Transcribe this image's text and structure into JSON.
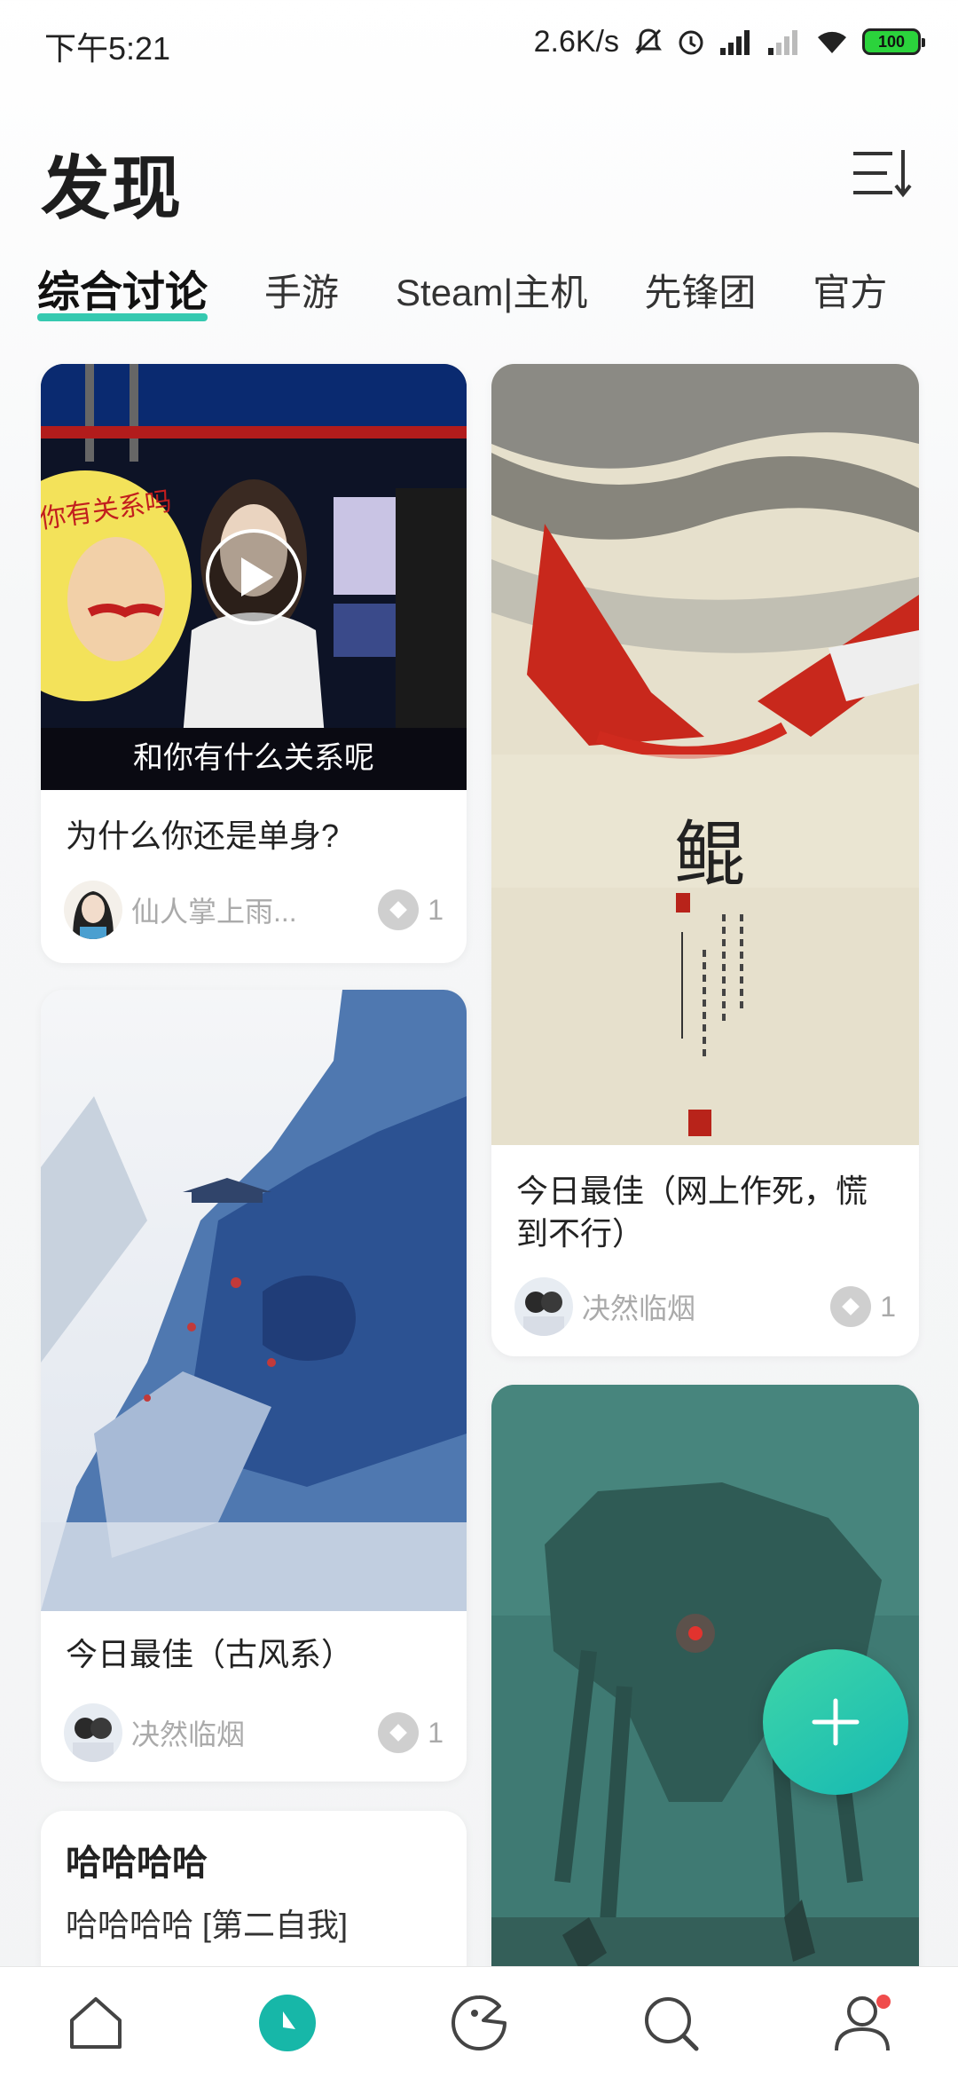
{
  "status_bar": {
    "time": "下午5:21",
    "net_speed": "2.6K/s",
    "battery": "100"
  },
  "header": {
    "title": "发现"
  },
  "tabs": [
    {
      "label": "综合讨论",
      "active": true
    },
    {
      "label": "手游"
    },
    {
      "label": "Steam|主机"
    },
    {
      "label": "先锋团"
    },
    {
      "label": "官方"
    }
  ],
  "cards": {
    "c1": {
      "title": "为什么你还是单身?",
      "author": "仙人掌上雨...",
      "likes": "1",
      "subtitle_text": "和你有什么关系呢",
      "sign_text": "你有关系吗"
    },
    "c2": {
      "title": "今日最佳（网上作死，慌到不行）",
      "author": "决然临烟",
      "likes": "1",
      "calligraphy": "鲲"
    },
    "c3": {
      "title": "今日最佳（古风系）",
      "author": "决然临烟",
      "likes": "1"
    },
    "c4": {
      "title": "哈哈哈哈",
      "body": "哈哈哈哈 [第二自我]"
    }
  },
  "colors": {
    "accent": "#35c9b0",
    "fab": "#1bbcb0",
    "badge": "#f04c4c"
  },
  "nav": {
    "items": [
      "home-icon",
      "discover-icon",
      "game-icon",
      "search-icon",
      "profile-icon"
    ]
  }
}
